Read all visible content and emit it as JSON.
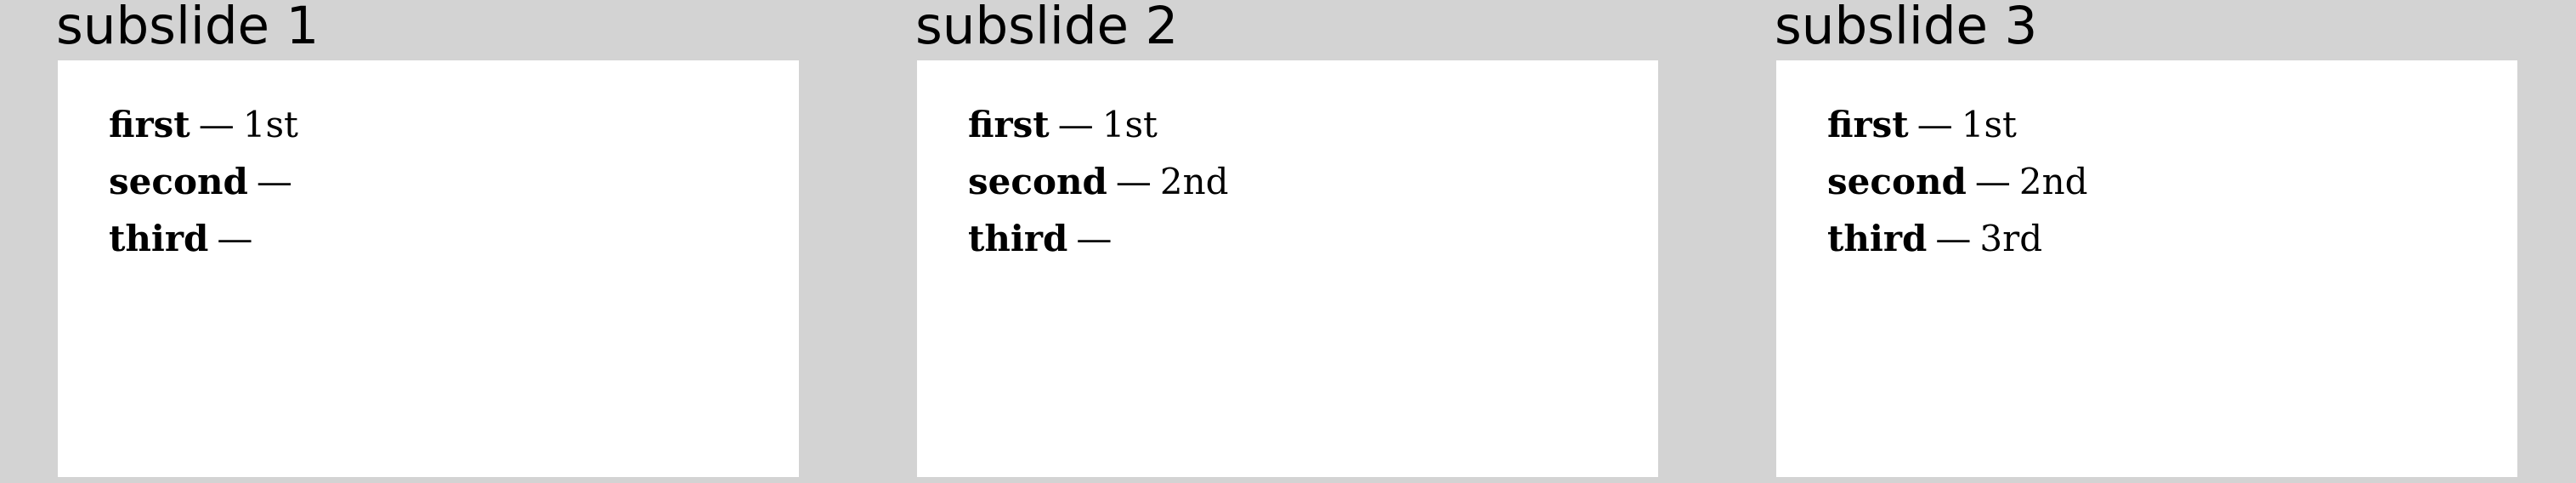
{
  "subslides": [
    {
      "title": "subslide 1",
      "rows": [
        {
          "term": "first",
          "dash": "—",
          "description": "1st"
        },
        {
          "term": "second",
          "dash": "—",
          "description": ""
        },
        {
          "term": "third",
          "dash": "—",
          "description": ""
        }
      ]
    },
    {
      "title": "subslide 2",
      "rows": [
        {
          "term": "first",
          "dash": "—",
          "description": "1st"
        },
        {
          "term": "second",
          "dash": "—",
          "description": "2nd"
        },
        {
          "term": "third",
          "dash": "—",
          "description": ""
        }
      ]
    },
    {
      "title": "subslide 3",
      "rows": [
        {
          "term": "first",
          "dash": "—",
          "description": "1st"
        },
        {
          "term": "second",
          "dash": "—",
          "description": "2nd"
        },
        {
          "term": "third",
          "dash": "—",
          "description": "3rd"
        }
      ]
    }
  ]
}
